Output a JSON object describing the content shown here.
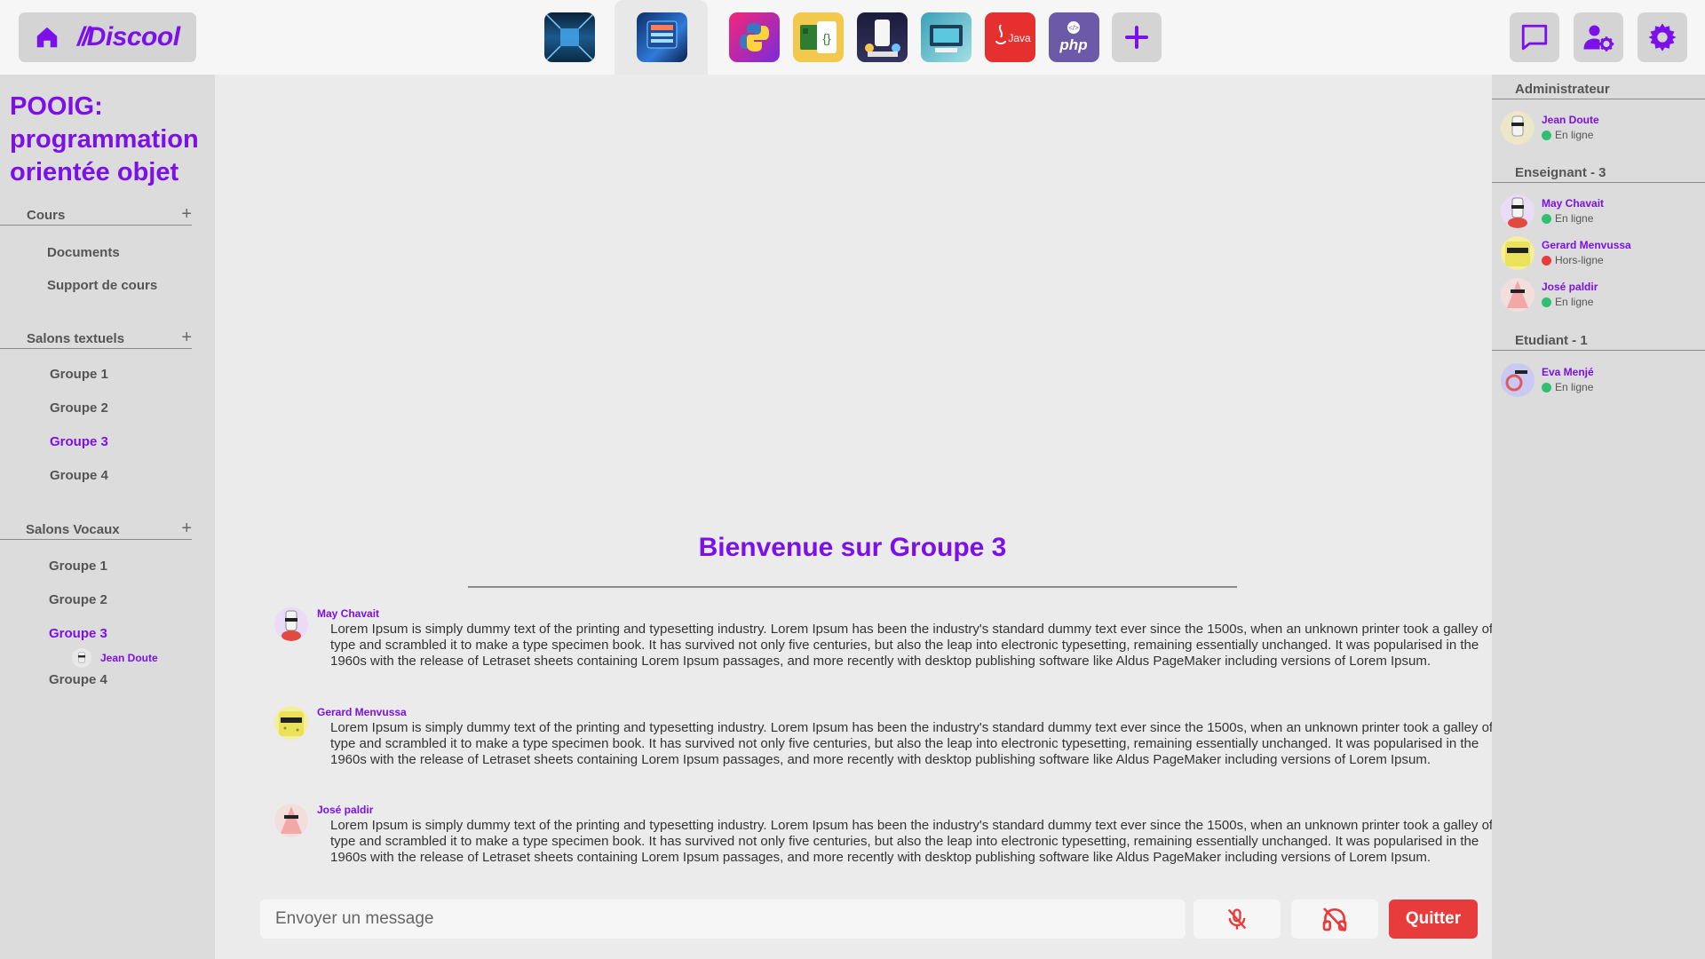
{
  "app": {
    "logo": "Discool"
  },
  "colors": {
    "accent": "#7b10e8",
    "online": "#2fbf71",
    "offline": "#e83b3b",
    "quit": "#e83b3b"
  },
  "servers": [
    {
      "name": "server-corridor-icon",
      "style": "blue-corridor"
    },
    {
      "name": "server-datacenter-icon",
      "style": "blue-datacenter",
      "active": true
    },
    {
      "name": "python-icon"
    },
    {
      "name": "raspberry-code-icon"
    },
    {
      "name": "mobile-dev-icon"
    },
    {
      "name": "dev-desk-icon"
    },
    {
      "name": "java-icon",
      "label": "Java"
    },
    {
      "name": "php-icon",
      "label": "php"
    }
  ],
  "left": {
    "course_title": "POOIG: programmation orientée objet",
    "cours": {
      "title": "Cours",
      "items": [
        "Documents",
        "Support de cours"
      ]
    },
    "textuels": {
      "title": "Salons textuels",
      "items": [
        "Groupe 1",
        "Groupe 2",
        "Groupe 3",
        "Groupe 4"
      ]
    },
    "vocaux": {
      "title": "Salons Vocaux",
      "items": [
        "Groupe 1",
        "Groupe 2",
        "Groupe 3",
        "Groupe 4"
      ],
      "connected_user": "Jean Doute"
    }
  },
  "main": {
    "welcome": "Bienvenue sur Groupe 3",
    "messages": [
      {
        "author": "May Chavait",
        "text": "Lorem Ipsum is simply dummy text of the printing and typesetting industry. Lorem Ipsum has been the industry's standard dummy text ever since the 1500s, when an unknown printer took a galley of type and scrambled it to make a type specimen book. It has survived not only five centuries, but also the leap into electronic typesetting, remaining essentially unchanged. It was popularised in the 1960s with the release of Letraset sheets containing Lorem Ipsum passages, and more recently with desktop publishing software like Aldus PageMaker including versions of Lorem Ipsum."
      },
      {
        "author": "Gerard Menvussa",
        "text": "Lorem Ipsum is simply dummy text of the printing and typesetting industry. Lorem Ipsum has been the industry's standard dummy text ever since the 1500s, when an unknown printer took a galley of type and scrambled it to make a type specimen book. It has survived not only five centuries, but also the leap into electronic typesetting, remaining essentially unchanged. It was popularised in the 1960s with the release of Letraset sheets containing Lorem Ipsum passages, and more recently with desktop publishing software like Aldus PageMaker including versions of Lorem Ipsum."
      },
      {
        "author": "José paldir",
        "text": "Lorem Ipsum is simply dummy text of the printing and typesetting industry. Lorem Ipsum has been the industry's standard dummy text ever since the 1500s, when an unknown printer took a galley of type and scrambled it to make a type specimen book. It has survived not only five centuries, but also the leap into electronic typesetting, remaining essentially unchanged. It was popularised in the 1960s with the release of Letraset sheets containing Lorem Ipsum passages, and more recently with desktop publishing software like Aldus PageMaker including versions of Lorem Ipsum."
      }
    ],
    "composer_placeholder": "Envoyer un message",
    "quit_label": "Quitter"
  },
  "right": {
    "admin": {
      "title": "Administrateur",
      "members": [
        {
          "name": "Jean Doute",
          "status": "En ligne"
        }
      ]
    },
    "teachers": {
      "title": "Enseignant - 3",
      "members": [
        {
          "name": "May Chavait",
          "status": "En ligne"
        },
        {
          "name": "Gerard Menvussa",
          "status": "Hors-ligne"
        },
        {
          "name": "José paldir",
          "status": "En ligne"
        }
      ]
    },
    "students": {
      "title": "Etudiant - 1",
      "members": [
        {
          "name": "Eva Menjé",
          "status": "En ligne"
        }
      ]
    }
  }
}
